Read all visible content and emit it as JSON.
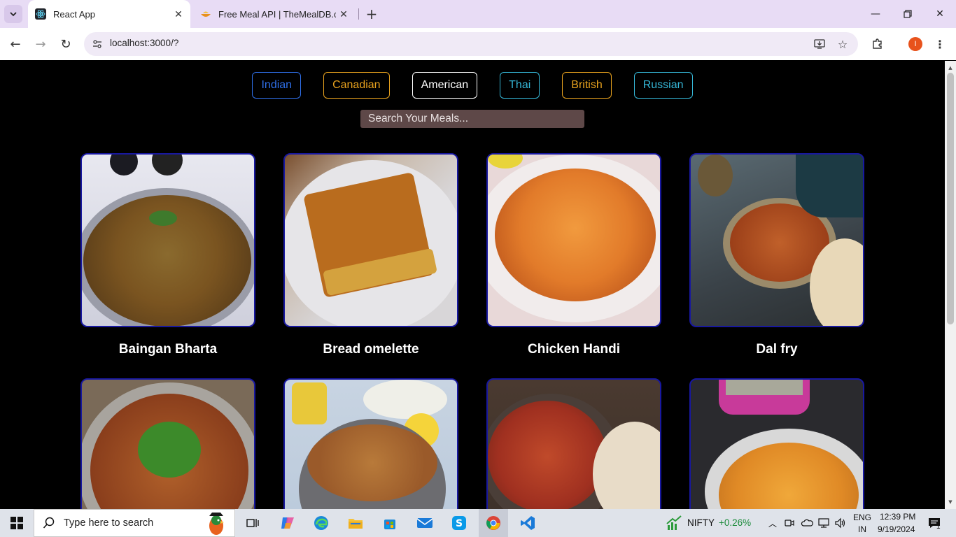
{
  "browser": {
    "tabs": [
      {
        "title": "React App",
        "active": true
      },
      {
        "title": "Free Meal API | TheMealDB.com",
        "active": false
      }
    ],
    "url": "localhost:3000/?",
    "profile_initial": "I"
  },
  "page": {
    "categories": [
      {
        "label": "Indian",
        "color": "#2f6fe8"
      },
      {
        "label": "Canadian",
        "color": "#e8a21e"
      },
      {
        "label": "American",
        "color": "#ffffff"
      },
      {
        "label": "Thai",
        "color": "#35b6d6"
      },
      {
        "label": "British",
        "color": "#e8a21e"
      },
      {
        "label": "Russian",
        "color": "#35b6d6"
      }
    ],
    "search_placeholder": "Search Your Meals...",
    "meals": [
      {
        "name": "Baingan Bharta"
      },
      {
        "name": "Bread omelette"
      },
      {
        "name": "Chicken Handi"
      },
      {
        "name": "Dal fry"
      },
      {
        "name": ""
      },
      {
        "name": ""
      },
      {
        "name": ""
      },
      {
        "name": ""
      }
    ]
  },
  "taskbar": {
    "search_placeholder": "Type here to search",
    "stock_name": "NIFTY",
    "stock_change": "+0.26%",
    "language": "ENG",
    "region": "IN",
    "time": "12:39 PM",
    "date": "9/19/2024",
    "notification_count": "1"
  }
}
